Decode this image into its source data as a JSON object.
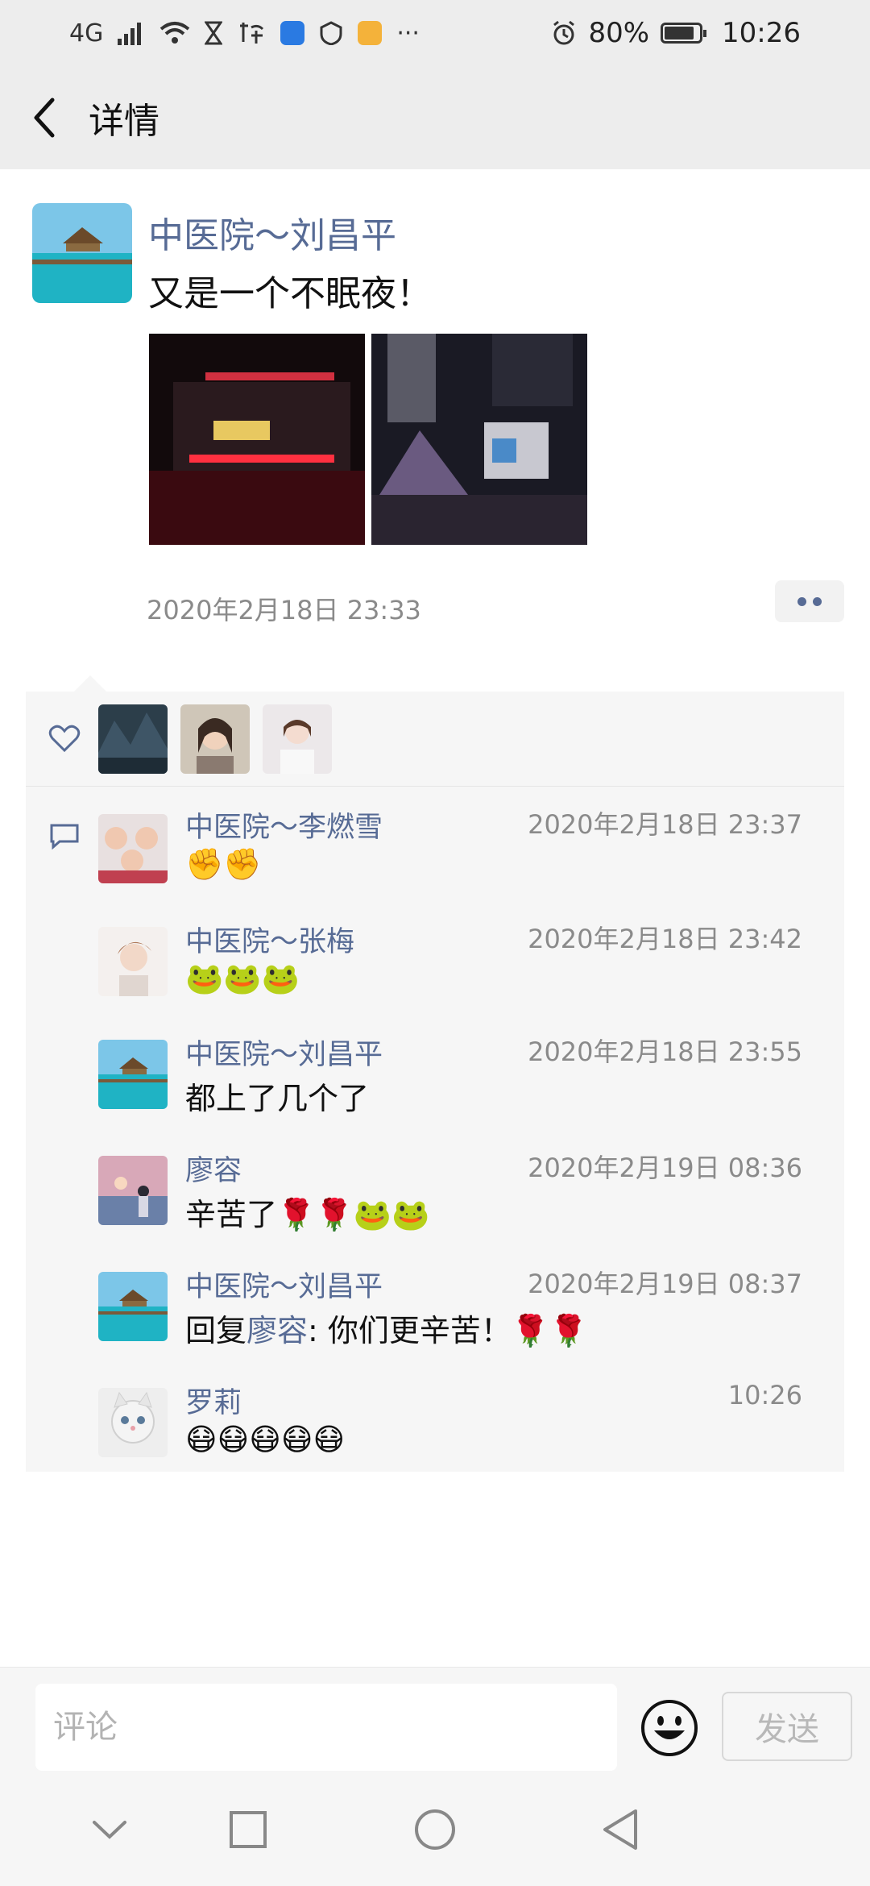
{
  "status_bar": {
    "network": "4G",
    "more_indicator": "···",
    "battery": "80%",
    "time": "10:26",
    "icons": [
      "signal-icon",
      "wifi-icon",
      "hourglass-icon",
      "app-icon",
      "app-icon",
      "shield-icon",
      "app-icon",
      "alarm-icon",
      "battery-icon"
    ]
  },
  "header": {
    "title": "详情",
    "back_icon": "back-arrow-icon"
  },
  "post": {
    "author": "中医院～刘昌平",
    "text": "又是一个不眠夜！",
    "timestamp": "2020年2月18日 23:33",
    "photos": 2
  },
  "likes": {
    "icon": "heart-icon",
    "count": 3
  },
  "comments": [
    {
      "name": "中医院～李燃雪",
      "time": "2020年2月18日 23:37",
      "text": "✊✊"
    },
    {
      "name": "中医院～张梅",
      "time": "2020年2月18日 23:42",
      "text": "🐸🐸🐸"
    },
    {
      "name": "中医院～刘昌平",
      "time": "2020年2月18日 23:55",
      "text": "都上了几个了"
    },
    {
      "name": "廖容",
      "time": "2020年2月19日 08:36",
      "text": "辛苦了🌹🌹🐸🐸"
    },
    {
      "name": "中医院～刘昌平",
      "time": "2020年2月19日 08:37",
      "reply_prefix": "回复",
      "reply_to": "廖容",
      "reply_text": ": 你们更辛苦！🌹🌹"
    },
    {
      "name": "罗莉",
      "time": "10:26",
      "text": "😷😷😷😷😷"
    }
  ],
  "input_bar": {
    "placeholder": "评论",
    "send_label": "发送",
    "emoji_icon": "smiley-icon"
  },
  "colors": {
    "link": "#576b95",
    "header_bg": "#ededed",
    "panel_bg": "#f6f6f6"
  }
}
